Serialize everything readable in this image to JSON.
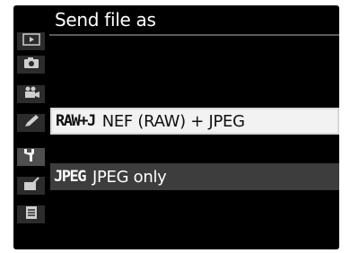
{
  "menu": {
    "title": "Send file as"
  },
  "sidebar": {
    "tabs": [
      {
        "icon": "playback-icon"
      },
      {
        "icon": "camera-icon"
      },
      {
        "icon": "movie-camera-icon"
      },
      {
        "icon": "pencil-icon"
      },
      {
        "icon": "wrench-icon",
        "active": true
      },
      {
        "icon": "retouch-icon"
      },
      {
        "icon": "recent-settings-icon"
      }
    ]
  },
  "options": [
    {
      "badge": "RAW+J",
      "label": "NEF (RAW) + JPEG",
      "selected": true
    },
    {
      "badge": "JPEG",
      "label": "JPEG only",
      "selected": false
    }
  ],
  "colors": {
    "background": "#000000",
    "highlight": "#f2f2f2",
    "option_bg": "#3d3d3d",
    "tab_bg": "#2c2c2c"
  }
}
